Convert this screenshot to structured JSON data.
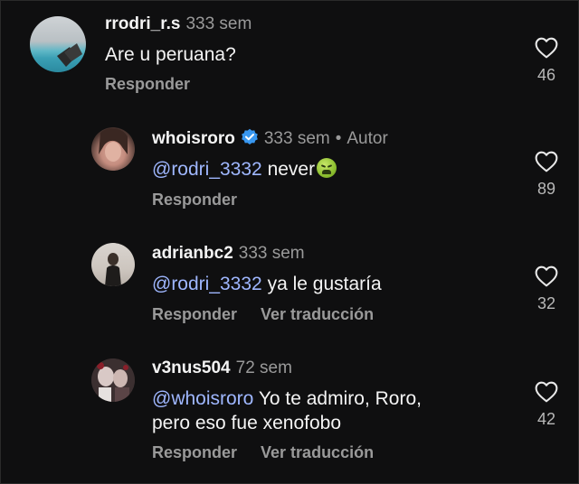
{
  "comments": [
    {
      "username": "rrodri_r.s",
      "time": "333 sem",
      "text": "Are u peruana?",
      "actions": [
        "Responder"
      ],
      "likes": "46"
    },
    {
      "username": "whoisroro",
      "time": "333 sem",
      "author_label": "Autor",
      "mention": "@rodri_3332",
      "text": " never",
      "actions": [
        "Responder"
      ],
      "likes": "89",
      "verified": true,
      "emoji": "nauseated-face"
    },
    {
      "username": "adrianbc2",
      "time": "333 sem",
      "mention": "@rodri_3332",
      "text": " ya le gustaría",
      "actions": [
        "Responder",
        "Ver traducción"
      ],
      "likes": "32"
    },
    {
      "username": "v3nus504",
      "time": "72 sem",
      "mention": "@whoisroro",
      "text": " Yo te admiro, Roro,",
      "text_line2": "pero eso fue xenofobo",
      "actions": [
        "Responder",
        "Ver traducción"
      ],
      "likes": "42"
    }
  ],
  "colors": {
    "background": "#0f0f10",
    "mention": "#9fb7ff",
    "verified": "#3897f0",
    "secondary_text": "#9a9a9a"
  },
  "icons": {
    "like": "heart-outline-icon",
    "verified": "verified-badge-icon"
  }
}
